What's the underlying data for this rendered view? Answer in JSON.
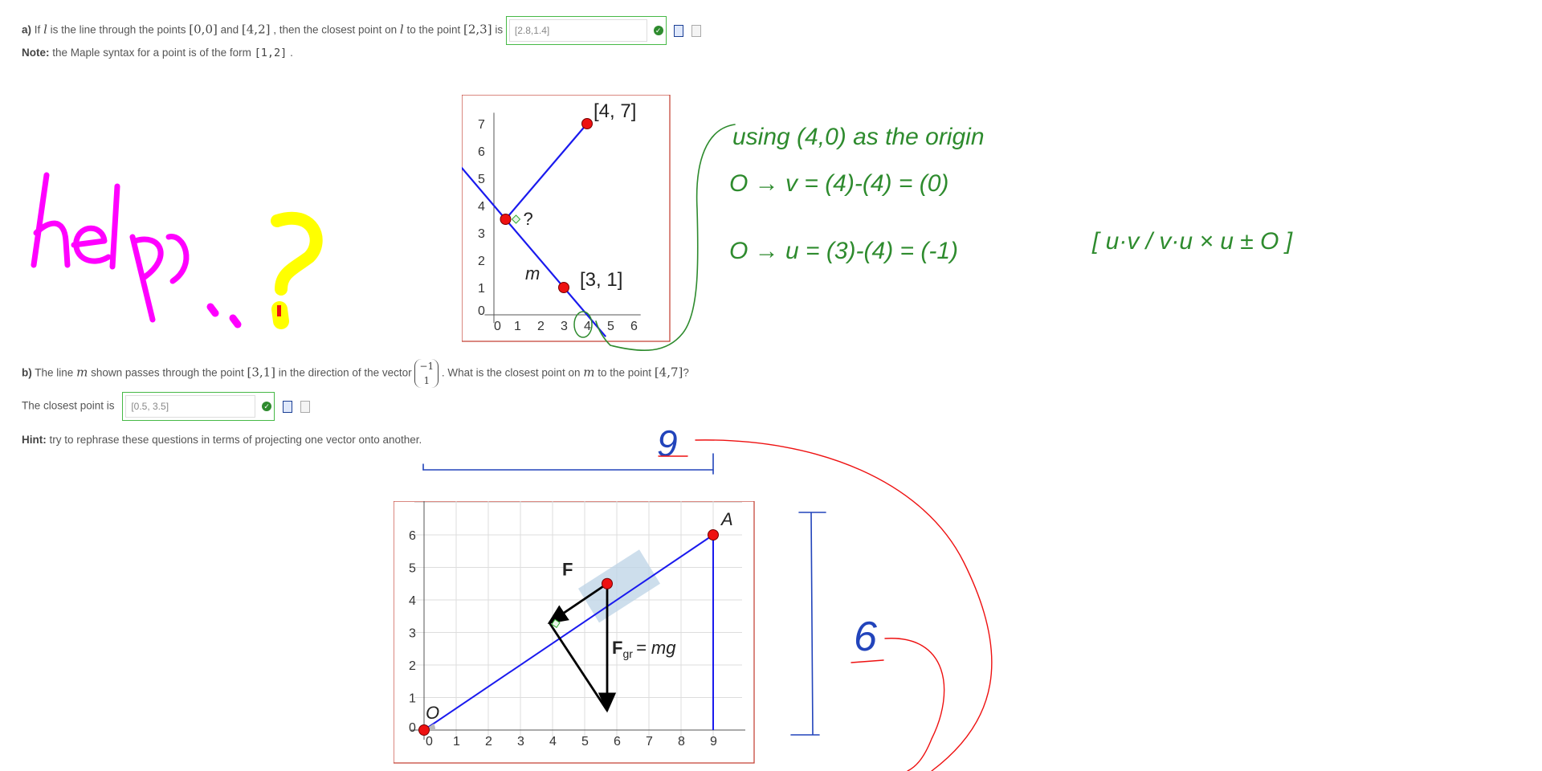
{
  "part_a": {
    "prefix": "a)",
    "text1": "If",
    "var_l": "l",
    "text2": "is the line through the points",
    "p1": "[0,0]",
    "text3": "and",
    "p2": "[4,2]",
    "text4": ", then the closest point on",
    "var_l2": "l",
    "text5": "to the point",
    "p3": "[2,3]",
    "text6": "is",
    "answer": "[2.8,1.4]"
  },
  "note": {
    "label": "Note:",
    "text": "the Maple syntax for a point is of the form",
    "example": "[1,2]",
    "end": "."
  },
  "graph1": {
    "x_ticks": [
      "0",
      "1",
      "2",
      "3",
      "4",
      "5",
      "6"
    ],
    "y_ticks": [
      "0",
      "1",
      "2",
      "3",
      "4",
      "5",
      "6",
      "7"
    ],
    "label_p47": "[4, 7]",
    "label_p31": "[3, 1]",
    "label_q": "?",
    "label_m": "m"
  },
  "part_b": {
    "prefix": "b)",
    "text1": "The line",
    "var_m": "m",
    "text2": "shown passes through the point",
    "point": "[3,1]",
    "text3": "in the direction of the vector",
    "vec_top": "−1",
    "vec_bottom": "1",
    "text4": ". What is the closest point on",
    "var_m2": "m",
    "text5": "to the point",
    "point2": "[4,7]",
    "text6": "?",
    "closest_label": "The closest point is",
    "answer": "[0.5, 3.5]"
  },
  "hint": {
    "label": "Hint:",
    "text": "try to rephrase these questions in terms of projecting one vector onto another."
  },
  "graph2": {
    "x_ticks": [
      "0",
      "1",
      "2",
      "3",
      "4",
      "5",
      "6",
      "7",
      "8",
      "9"
    ],
    "y_ticks": [
      "0",
      "1",
      "2",
      "3",
      "4",
      "5",
      "6"
    ],
    "label_A": "A",
    "label_O": "O",
    "label_F": "F",
    "label_Fgr": "F",
    "label_gr": "gr",
    "label_mg": "= mg"
  },
  "annotations": {
    "help": "help..?",
    "green_line1": "using (4,0) as the origin",
    "green_line2": "O → v = (4)-(4) = (0)",
    "green_line3": "O → u = (3)-(4) = (-1)",
    "green_formula": "[ u·v / v·u × u ± O ]",
    "blue_9": "9",
    "blue_6": "6"
  },
  "colors": {
    "accent_green": "#46b946",
    "graph_border": "#c0392b",
    "line_blue": "#1a1aee",
    "point_red": "#ee1111",
    "ink_magenta": "#ff00ff",
    "ink_yellow": "#ffff00",
    "ink_green": "#2e8b2e",
    "ink_red": "#ee1111",
    "ink_blue": "#2244bb"
  }
}
